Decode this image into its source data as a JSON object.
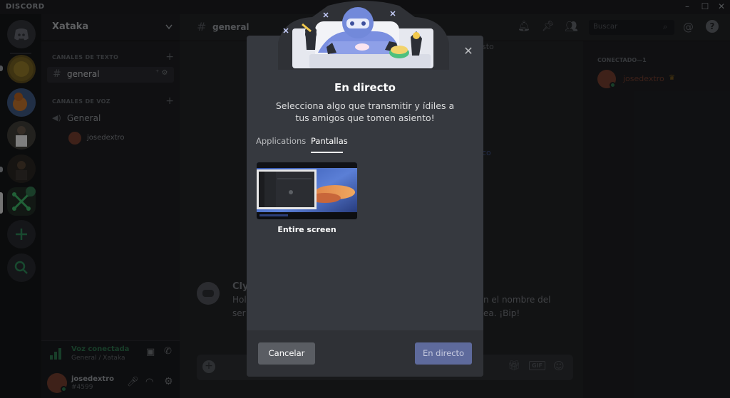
{
  "titlebar": {
    "brand": "DISCORD"
  },
  "sidebar": {
    "server_name": "Xataka",
    "text_category": "CANALES DE TEXTO",
    "text_channels": [
      {
        "name": "general"
      }
    ],
    "voice_category": "CANALES DE VOZ",
    "voice_channels": [
      {
        "name": "General"
      }
    ],
    "voice_user": "josedextro",
    "voice_status": "Voz conectada",
    "voice_location": "General / Xataka",
    "user_name": "josedextro",
    "user_tag": "#4599"
  },
  "chat": {
    "channel_name": "general",
    "welcome_sender": "Cly",
    "welcome_text_left": "Hol",
    "welcome_text_left2": "ser",
    "welcome_text_right": "n el nombre del",
    "welcome_text_right2": "ea. ¡Bip!",
    "header_partial": "sto",
    "mid_partial": "co"
  },
  "header": {
    "search_placeholder": "Buscar"
  },
  "members": {
    "category": "CONECTADO—1",
    "user": "josedextro"
  },
  "modal": {
    "title": "En directo",
    "subtitle": "Selecciona algo que transmitir y ídiles a tus amigos que tomen asiento!",
    "tabs": [
      {
        "label": "Applications",
        "active": false
      },
      {
        "label": "Pantallas",
        "active": true
      }
    ],
    "screen_label": "Entire screen",
    "cancel_label": "Cancelar",
    "go_live_label": "En directo"
  },
  "colors": {
    "accent": "#7289da",
    "green": "#43b581",
    "background": "#36393f"
  }
}
